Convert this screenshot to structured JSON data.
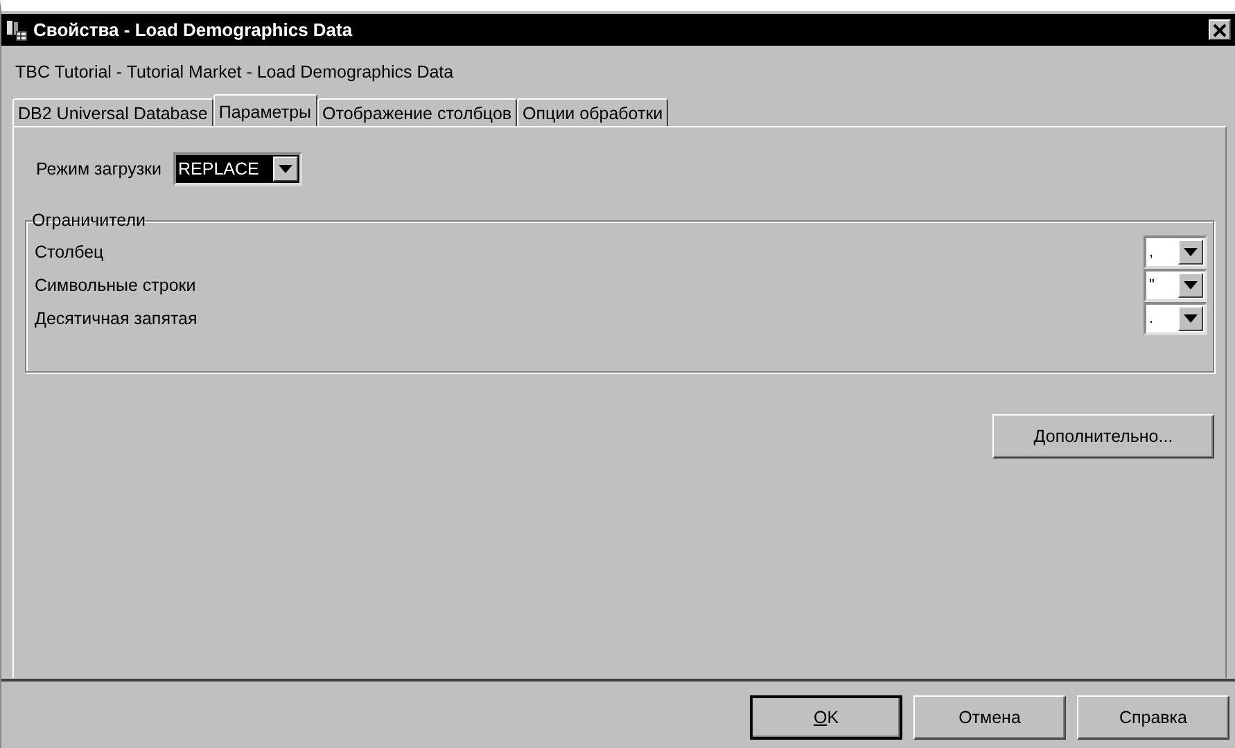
{
  "window": {
    "title": "Свойства - Load Demographics Data"
  },
  "subtitle": "TBC Tutorial - Tutorial Market - Load Demographics Data",
  "tabs": [
    {
      "label": "DB2 Universal Database",
      "selected": false
    },
    {
      "label": "Параметры",
      "selected": true
    },
    {
      "label": "Отображение столбцов",
      "selected": false
    },
    {
      "label": "Опции обработки",
      "selected": false
    }
  ],
  "load_mode": {
    "label": "Режим загрузки",
    "value": "REPLACE"
  },
  "delimiters": {
    "title": "Ограничители",
    "rows": [
      {
        "label": "Столбец",
        "value": ","
      },
      {
        "label": "Символьные строки",
        "value": "\""
      },
      {
        "label": "Десятичная запятая",
        "value": "."
      }
    ]
  },
  "advanced_button": "Дополнительно...",
  "buttons": [
    {
      "label": "OK",
      "default": true
    },
    {
      "label": "Отмена",
      "default": false
    },
    {
      "label": "Справка",
      "default": false
    }
  ]
}
